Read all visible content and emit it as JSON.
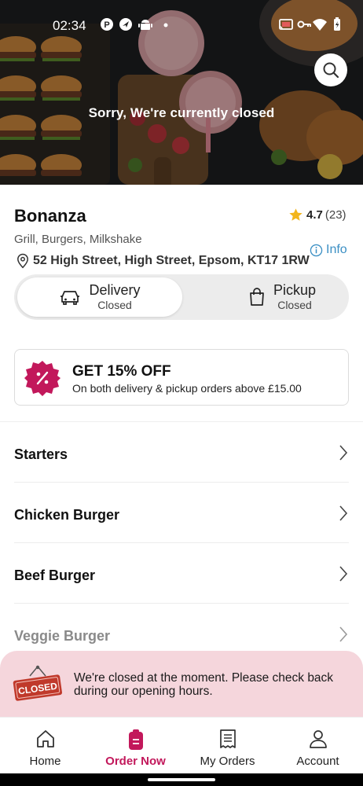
{
  "status_bar": {
    "time": "02:34",
    "left_icons": [
      "letter-p-icon",
      "location-arrow-icon",
      "android-icon",
      "dot-icon"
    ],
    "right_icons": [
      "cast-icon",
      "vpn-key-icon",
      "wifi-icon",
      "battery-icon"
    ]
  },
  "hero": {
    "closed_text": "Sorry, We're currently closed",
    "search_icon": "search-icon"
  },
  "restaurant": {
    "name": "Bonanza",
    "rating": "4.7",
    "rating_count": "(23)",
    "cuisine": "Grill, Burgers, Milkshake",
    "address": "52 High Street, High Street, Epsom, KT17 1RW",
    "info_label": "Info"
  },
  "modes": [
    {
      "label": "Delivery",
      "status": "Closed",
      "icon": "car-icon",
      "selected": true
    },
    {
      "label": "Pickup",
      "status": "Closed",
      "icon": "shopping-bag-icon",
      "selected": false
    }
  ],
  "offer": {
    "title": "GET 15% OFF",
    "subtitle": "On both delivery & pickup orders above £15.00",
    "icon": "percent-badge-icon",
    "color": "#c2185b"
  },
  "categories": [
    "Starters",
    "Chicken Burger",
    "Beef Burger",
    "Veggie Burger"
  ],
  "closed_notice": {
    "sign_text": "CLOSED",
    "message": "We're closed at the moment. Please check back during our opening hours.",
    "background": "#f5d6dc"
  },
  "bottom_nav": [
    {
      "label": "Home",
      "icon": "home-icon",
      "active": false
    },
    {
      "label": "Order Now",
      "icon": "order-icon",
      "active": true
    },
    {
      "label": "My Orders",
      "icon": "receipt-icon",
      "active": false
    },
    {
      "label": "Account",
      "icon": "user-icon",
      "active": false
    }
  ],
  "colors": {
    "accent": "#c2185b",
    "info_link": "#3b8fc4",
    "star": "#f2b51c"
  }
}
